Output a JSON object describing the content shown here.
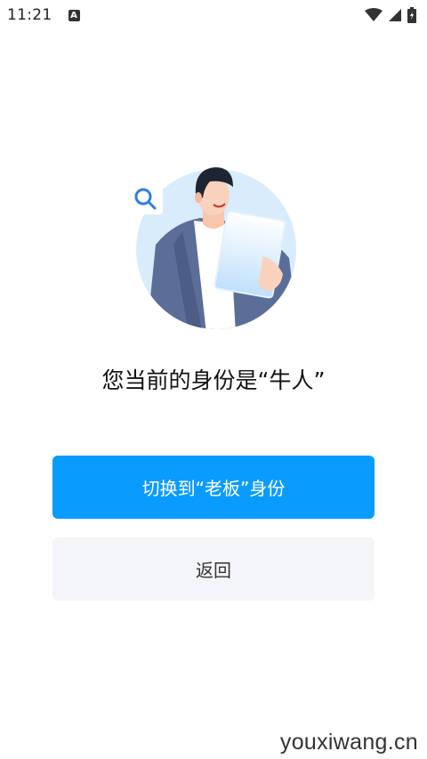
{
  "status_bar": {
    "time": "11:21",
    "notification_icon_letter": "A",
    "icons": [
      "wifi-icon",
      "signal-icon",
      "battery-icon"
    ]
  },
  "illustration": {
    "icons": [
      "search-icon",
      "person-illustration",
      "document-illustration"
    ],
    "colors": {
      "circle": "#d8ecfb",
      "suit": "#5b6e97",
      "hair": "#1f2433",
      "search": "#2f7de1"
    }
  },
  "main": {
    "identity_text": "您当前的身份是“牛人”"
  },
  "buttons": {
    "switch_label": "切换到“老板”身份",
    "back_label": "返回"
  },
  "watermark": "youxiwang.cn",
  "colors": {
    "primary": "#0a9bff",
    "secondary_bg": "#f4f5f9",
    "text": "#111111"
  }
}
